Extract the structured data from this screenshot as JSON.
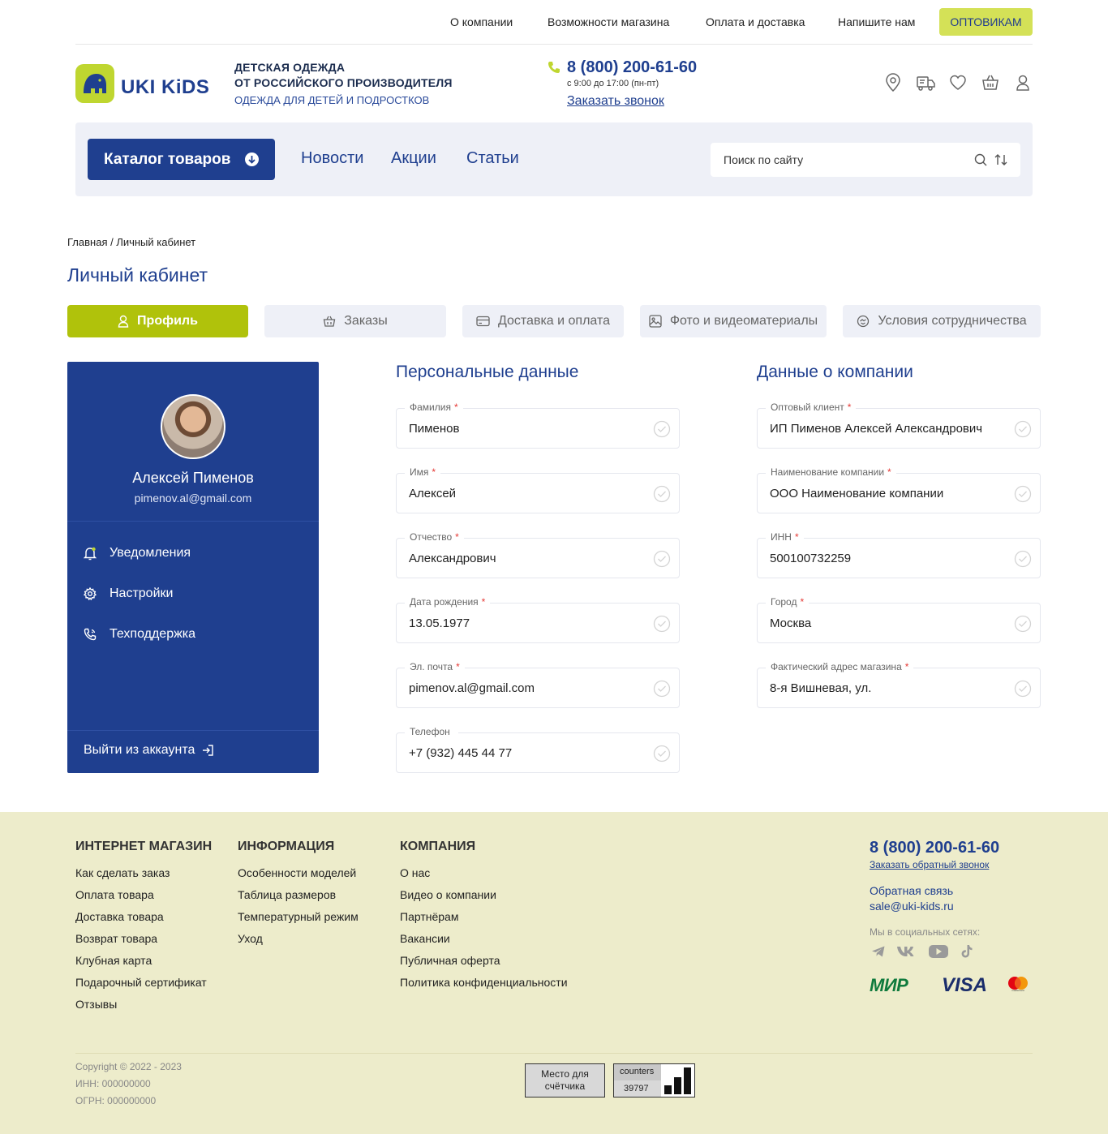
{
  "topnav": {
    "links": [
      "О компании",
      "Возможности магазина",
      "Оплата и доставка",
      "Напишите нам"
    ],
    "wholesale": "ОПТОВИКАМ"
  },
  "header": {
    "logo_text": "UKI KiDS",
    "tagline1": "ДЕТСКАЯ ОДЕЖДА",
    "tagline2": "ОТ РОССИЙСКОГО ПРОИЗВОДИТЕЛЯ",
    "tagline3": "ОДЕЖДА ДЛЯ ДЕТЕЙ И ПОДРОСТКОВ",
    "phone": "8 (800) 200-61-60",
    "hours": "с 9:00 до 17:00 (пн-пт)",
    "callback": "Заказать звонок",
    "icons": [
      "location-icon",
      "delivery-truck-icon",
      "heart-icon",
      "basket-icon",
      "user-icon"
    ]
  },
  "menu": {
    "catalog": "Каталог товаров",
    "links": [
      "Новости",
      "Акции",
      "Статьи"
    ],
    "search_placeholder": "Поиск по сайту"
  },
  "breadcrumb": "Главная / Личный кабинет",
  "page_title": "Личный кабинет",
  "tabs": [
    {
      "label": "Профиль",
      "icon": "user-icon",
      "active": true
    },
    {
      "label": "Заказы",
      "icon": "basket-icon",
      "active": false
    },
    {
      "label": "Доставка и оплата",
      "icon": "card-icon",
      "active": false
    },
    {
      "label": "Фото и видеоматериалы",
      "icon": "image-icon",
      "active": false
    },
    {
      "label": "Условия сотрудничества",
      "icon": "handshake-icon",
      "active": false
    }
  ],
  "profile": {
    "name": "Алексей Пименов",
    "email": "pimenov.al@gmail.com",
    "menu": [
      {
        "label": "Уведомления",
        "icon": "bell-icon"
      },
      {
        "label": "Настройки",
        "icon": "gear-icon"
      },
      {
        "label": "Техподдержка",
        "icon": "phone-icon"
      }
    ],
    "logout": "Выйти из аккаунта"
  },
  "personal": {
    "title": "Персональные данные",
    "fields": [
      {
        "label": "Фамилия",
        "value": "Пименов",
        "required": "*"
      },
      {
        "label": "Имя",
        "value": "Алексей",
        "required": "*"
      },
      {
        "label": "Отчество",
        "value": "Александрович",
        "required": "*"
      },
      {
        "label": "Дата рождения",
        "value": "13.05.1977",
        "required": "*"
      },
      {
        "label": "Эл. почта",
        "value": "pimenov.al@gmail.com",
        "required": "*"
      },
      {
        "label": "Телефон",
        "value": "+7 (932) 445 44 77",
        "required": ""
      }
    ]
  },
  "company": {
    "title": "Данные о компании",
    "fields": [
      {
        "label": "Оптовый клиент",
        "value": "ИП Пименов Алексей Александрович",
        "required": "*"
      },
      {
        "label": "Наименование компании",
        "value": "ООО Наименование компании",
        "required": "*"
      },
      {
        "label": "ИНН",
        "value": "500100732259",
        "required": "*"
      },
      {
        "label": "Город",
        "value": "Москва",
        "required": "*"
      },
      {
        "label": "Фактический адрес магазина",
        "value": "8-я Вишневая, ул.",
        "required": "*"
      }
    ]
  },
  "footer": {
    "cols": [
      {
        "title": "ИНТЕРНЕТ МАГАЗИН",
        "links": [
          "Как сделать заказ",
          "Оплата товара",
          "Доставка товара",
          "Возврат товара",
          "Клубная карта",
          "Подарочный сертификат",
          "Отзывы"
        ]
      },
      {
        "title": "ИНФОРМАЦИЯ",
        "links": [
          "Особенности моделей",
          "Таблица размеров",
          "Температурный режим",
          "Уход"
        ]
      },
      {
        "title": "КОМПАНИЯ",
        "links": [
          "О нас",
          "Видео о компании",
          "Партнёрам",
          "Вакансии",
          "Публичная оферта",
          "Политика конфиденциальности"
        ]
      }
    ],
    "phone": "8 (800) 200-61-60",
    "callback": "Заказать обратный звонок",
    "feedback": "Обратная связь",
    "email": "sale@uki-kids.ru",
    "social_label": "Мы в социальных сетях:",
    "social": [
      "telegram-icon",
      "vk-icon",
      "youtube-icon",
      "tiktok-icon"
    ],
    "payments": [
      "МИР",
      "VISA",
      "mastercard"
    ],
    "copyright": "Copyright © 2022 - 2023",
    "inn": "ИНН: 000000000",
    "ogrn": "ОГРН: 000000000",
    "counter_placeholder": "Место для счётчика",
    "counter_label": "counters",
    "counter_value": "39797"
  },
  "colors": {
    "brand_blue": "#1f3f8f",
    "accent_green": "#b0c20b",
    "wholesale_bg": "#d4e157",
    "footer_bg": "#edeccb"
  }
}
